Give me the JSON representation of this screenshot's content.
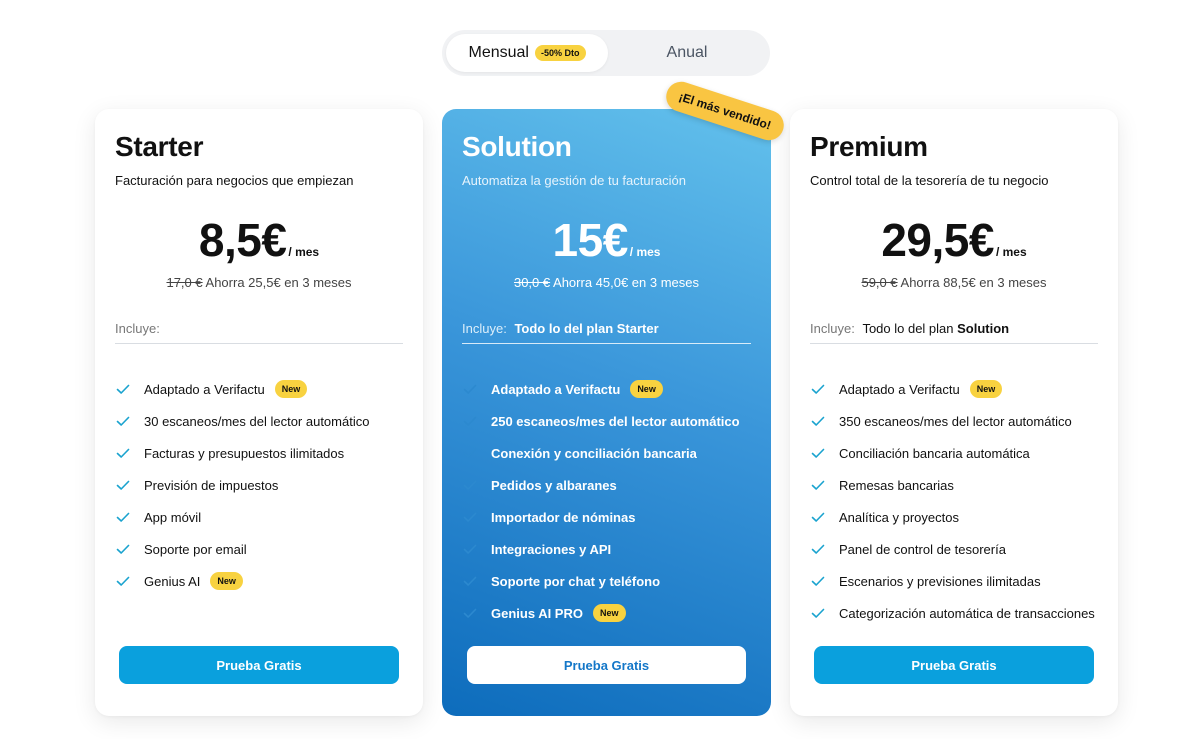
{
  "toggle": {
    "monthly_label": "Mensual",
    "monthly_badge": "-50% Dto",
    "annual_label": "Anual"
  },
  "ribbon": "¡El más vendido!",
  "plans": [
    {
      "name": "Starter",
      "description": "Facturación para negocios que empiezan",
      "price": "8,5€",
      "period": "/ mes",
      "old_price": "17,0 €",
      "savings": "Ahorra 25,5€ en 3 meses",
      "includes_label": "Incluye:",
      "includes_prefix": "",
      "includes_plan": "",
      "features": [
        {
          "text": "Adaptado a Verifactu",
          "badge": "New"
        },
        {
          "text": "30 escaneos/mes del lector automático",
          "badge": ""
        },
        {
          "text": "Facturas y presupuestos ilimitados",
          "badge": ""
        },
        {
          "text": "Previsión de impuestos",
          "badge": ""
        },
        {
          "text": "App móvil",
          "badge": ""
        },
        {
          "text": "Soporte por email",
          "badge": ""
        },
        {
          "text": "Genius AI",
          "badge": "New"
        }
      ],
      "cta": "Prueba Gratis"
    },
    {
      "name": "Solution",
      "description": "Automatiza la gestión de tu facturación",
      "price": "15€",
      "period": "/ mes",
      "old_price": "30,0 €",
      "savings": "Ahorra 45,0€ en 3 meses",
      "includes_label": "Incluye:",
      "includes_prefix": "Todo lo del plan",
      "includes_plan": "Starter",
      "features": [
        {
          "text": "Adaptado a Verifactu",
          "badge": "New"
        },
        {
          "text": "250 escaneos/mes del lector automático",
          "badge": ""
        },
        {
          "text": "Conexión y conciliación bancaria",
          "badge": ""
        },
        {
          "text": "Pedidos y albaranes",
          "badge": ""
        },
        {
          "text": "Importador de nóminas",
          "badge": ""
        },
        {
          "text": "Integraciones y API",
          "badge": ""
        },
        {
          "text": "Soporte por chat y teléfono",
          "badge": ""
        },
        {
          "text": "Genius AI PRO",
          "badge": "New"
        }
      ],
      "cta": "Prueba Gratis"
    },
    {
      "name": "Premium",
      "description": "Control total de la tesorería de tu negocio",
      "price": "29,5€",
      "period": "/ mes",
      "old_price": "59,0 €",
      "savings": "Ahorra 88,5€ en 3 meses",
      "includes_label": "Incluye:",
      "includes_prefix": "Todo lo del plan",
      "includes_plan": "Solution",
      "features": [
        {
          "text": "Adaptado a Verifactu",
          "badge": "New"
        },
        {
          "text": "350 escaneos/mes del lector automático",
          "badge": ""
        },
        {
          "text": "Conciliación bancaria automática",
          "badge": ""
        },
        {
          "text": "Remesas bancarias",
          "badge": ""
        },
        {
          "text": "Analítica y proyectos",
          "badge": ""
        },
        {
          "text": "Panel de control de tesorería",
          "badge": ""
        },
        {
          "text": "Escenarios y previsiones ilimitadas",
          "badge": ""
        },
        {
          "text": "Categorización automática de transacciones",
          "badge": ""
        }
      ],
      "cta": "Prueba Gratis"
    }
  ],
  "colors": {
    "accent": "#0aa0dd",
    "badge": "#f8d240",
    "check_light": "#1aa3cf",
    "check_blue": "#2c89cf"
  }
}
